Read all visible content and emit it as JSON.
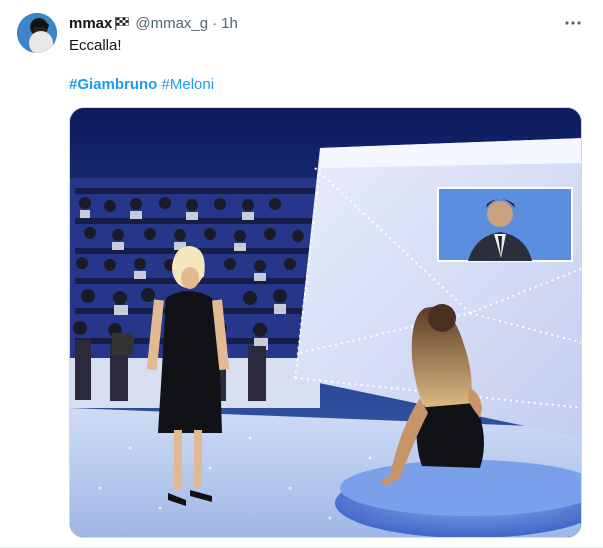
{
  "tweet": {
    "display_name": "mmax",
    "handle": "@mmax_g",
    "separator": "·",
    "time": "1h",
    "text": "Eccalla!",
    "hashtags": [
      "#Giambruno",
      "#Meloni"
    ]
  },
  "icons": {
    "name_emoji": "chequered-flag-icon",
    "more": "more-options-icon"
  },
  "colors": {
    "link": "#1d9bf0",
    "secondary_text": "#536471",
    "primary_text": "#0f1419"
  }
}
